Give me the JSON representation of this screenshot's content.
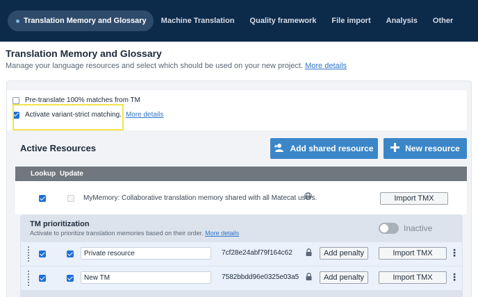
{
  "nav": {
    "tabs": [
      {
        "label": "Translation Memory and Glossary",
        "active": true
      },
      {
        "label": "Machine Translation"
      },
      {
        "label": "Quality framework"
      },
      {
        "label": "File import"
      },
      {
        "label": "Analysis"
      },
      {
        "label": "Other"
      }
    ]
  },
  "header": {
    "title": "Translation Memory and Glossary",
    "subtitle": "Manage your language resources and select which should be used on your new project.",
    "more_details": "More details"
  },
  "options": {
    "pretranslate": {
      "label": "Pre-translate 100% matches from TM",
      "checked": false
    },
    "variant_strict": {
      "label": "Activate variant-strict matching.",
      "link": "More details",
      "checked": true
    }
  },
  "resources": {
    "title": "Active Resources",
    "add_shared_label": "Add shared resource",
    "new_resource_label": "New resource",
    "columns": {
      "lookup": "Lookup",
      "update": "Update"
    },
    "mymemory": {
      "text": "MyMemory: Collaborative translation memory shared with all Matecat users.",
      "import_label": "Import TMX"
    }
  },
  "prioritization": {
    "title": "TM prioritization",
    "subtitle": "Activate to prioritize translation memories based on their order.",
    "link": "More details",
    "status": "Inactive"
  },
  "tms": [
    {
      "name": "Private resource",
      "key": "7cf28e24abf79f164c62",
      "penalty_label": "Add penalty",
      "import_label": "Import TMX"
    },
    {
      "name": "New TM",
      "key": "7582bbdd96e0325e03a5",
      "penalty_label": "Add penalty",
      "import_label": "Import TMX"
    }
  ],
  "colors": {
    "nav_bg": "#0c2a4a",
    "accent": "#3b86c8",
    "checkbox": "#1e6fd8",
    "highlight": "#f2e34a"
  }
}
